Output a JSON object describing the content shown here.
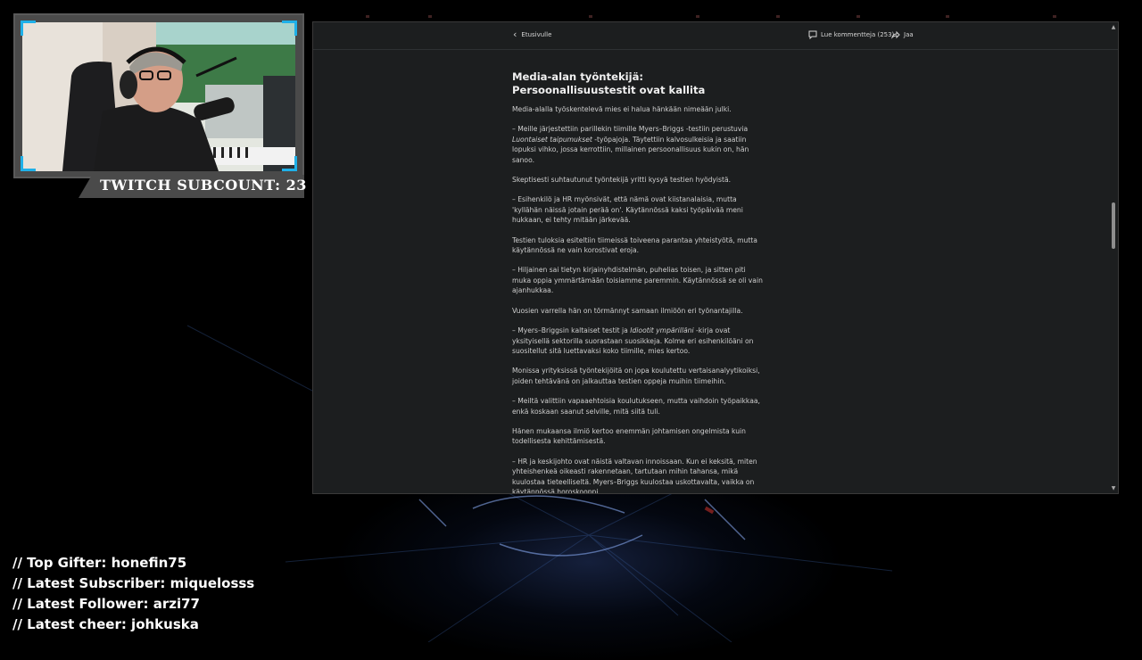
{
  "overlay": {
    "subcount": "TWITCH SUBCOUNT: 23",
    "stream_info": [
      "// Top Gifter: honefin75",
      "// Latest Subscriber: miquelosss",
      "// Latest Follower: arzi77",
      "// Latest cheer: johkuska"
    ],
    "accent_color": "#1fb0e8"
  },
  "browser": {
    "back_label": "Etusivulle",
    "comments_label": "Lue kommentteja (253)",
    "share_label": "Jaa",
    "article": {
      "heading": "Media-alan työntekijä: Persoonallisuustestit ovat kallita",
      "paragraphs": [
        "Media-alalla työskentelevä mies ei halua hänkään nimeään julki.",
        "– Meille järjestettiin parillekin tiimille Myers–Briggs -testiin perustuvia",
        "Luontaiset taipumukset",
        "-työpajoja. Täytettiin kalvosulkeisia ja saatiin lopuksi vihko, jossa kerrottiin, millainen persoonallisuus kukin on, hän sanoo.",
        "Skeptisesti suhtautunut työntekijä yritti kysyä testien hyödyistä.",
        "– Esihenkilö ja HR myönsivät, että nämä ovat kiistanalaisia, mutta 'kyllähän näissä jotain perää on'. Käytännössä kaksi työpäivää meni hukkaan, ei tehty mitään järkevää.",
        "Testien tuloksia esiteltiin tiimeissä toiveena parantaa yhteistyötä, mutta käytännössä ne vain korostivat eroja.",
        "– Hiljainen sai tietyn kirjainyhdistelmän, puhelias toisen, ja sitten piti muka oppia ymmärtämään toisiamme paremmin. Käytännössä se oli vain ajanhukkaa.",
        "Vuosien varrella hän on törmännyt samaan ilmiöön eri työnantajilla.",
        "– Myers–Briggsin kaltaiset testit ja",
        "Idiootit ympärilläni",
        "-kirja ovat yksityisellä sektorilla suorastaan suosikkeja. Kolme eri esihenkilöäni on suositellut sitä luettavaksi koko tiimille, mies kertoo.",
        "Monissa yrityksissä työntekijöitä on jopa koulutettu vertaisanalyytikoiksi, joiden tehtävänä on jalkauttaa testien oppeja muihin tiimeihin.",
        "– Meiltä valittiin vapaaehtoisia koulutukseen, mutta vaihdoin työpaikkaa, enkä koskaan saanut selville, mitä siitä tuli.",
        "Hänen mukaansa ilmiö kertoo enemmän johtamisen ongelmista kuin todellisesta kehittämisestä.",
        "– HR ja keskijohto ovat näistä valtavan innoissaan. Kun ei keksitä, miten yhteishenkeä oikeasti rakennetaan, tartutaan mihin tahansa, mikä kuulostaa tieteelliseltä. Myers–Briggs kuulostaa uskottavalta, vaikka on käytännössä horoskooppi."
      ]
    },
    "scroll_position": 0.42
  }
}
